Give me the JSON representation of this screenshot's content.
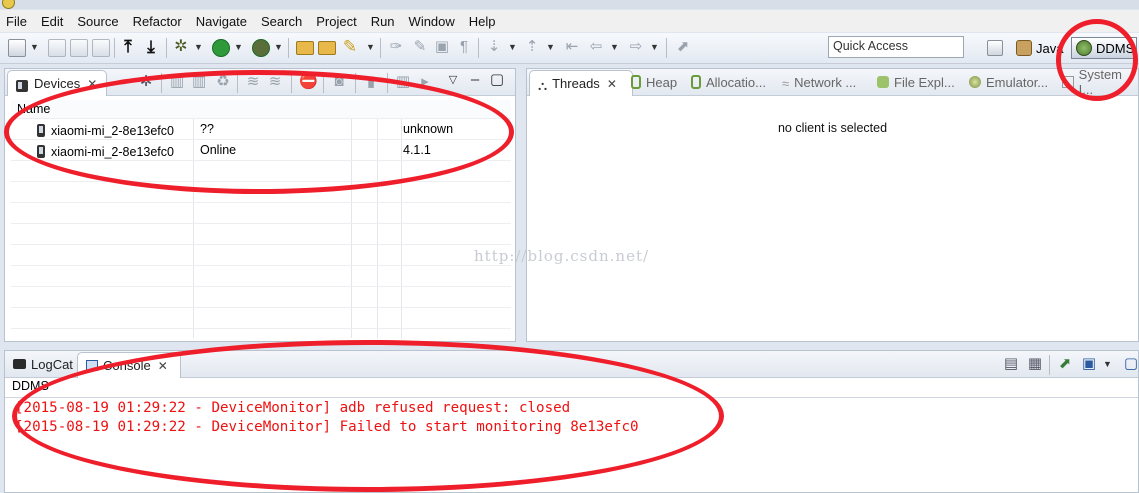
{
  "menu": [
    "File",
    "Edit",
    "Source",
    "Refactor",
    "Navigate",
    "Search",
    "Project",
    "Run",
    "Window",
    "Help"
  ],
  "toolbar": {
    "quick_access": "Quick Access",
    "perspectives": {
      "java": "Java",
      "ddms": "DDMS"
    }
  },
  "devices_panel": {
    "tab_label": "Devices",
    "column_name": "Name",
    "rows": [
      {
        "name": "xiaomi-mi_2-8e13efc0",
        "status": "??",
        "version": "unknown"
      },
      {
        "name": "xiaomi-mi_2-8e13efc0",
        "status": "Online",
        "version": "4.1.1"
      }
    ]
  },
  "right_panel": {
    "tabs": [
      "Threads",
      "Heap",
      "Allocatio...",
      "Network ...",
      "File Expl...",
      "Emulator...",
      "System I..."
    ],
    "message": "no client is selected"
  },
  "bottom_panel": {
    "tabs": [
      "LogCat",
      "Console"
    ],
    "console_name": "DDMS",
    "lines": [
      "[2015-08-19 01:29:22 - DeviceMonitor] adb refused request: closed",
      "[2015-08-19 01:29:22 - DeviceMonitor] Failed to start monitoring 8e13efc0"
    ]
  },
  "watermark": "http://blog.csdn.net/",
  "colors": {
    "error_text": "#ee1111",
    "annotation": "#ee1e2a"
  }
}
